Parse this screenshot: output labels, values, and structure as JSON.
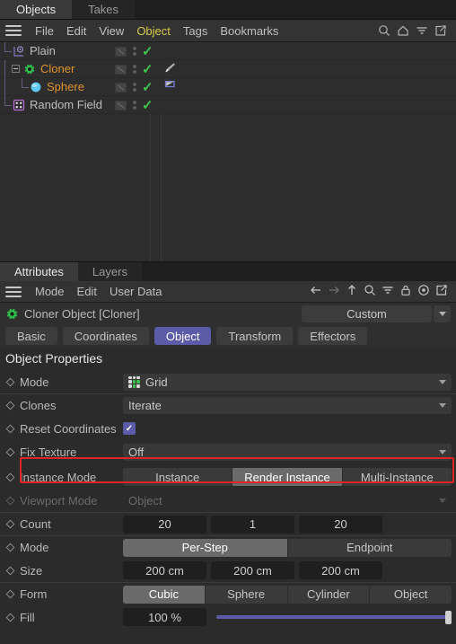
{
  "object_manager": {
    "tabs": [
      {
        "label": "Objects",
        "active": true
      },
      {
        "label": "Takes",
        "active": false
      }
    ],
    "menu": [
      "File",
      "Edit",
      "View",
      "Object",
      "Tags",
      "Bookmarks"
    ],
    "menu_highlight": "Object",
    "icons": [
      "search-icon",
      "home-icon",
      "filter-icon",
      "expand-icon"
    ],
    "tree": [
      {
        "name": "Plain",
        "icon": "plain-effector-icon",
        "color": "#bdbdbd",
        "depth": 0,
        "has_expander": false,
        "tag": null
      },
      {
        "name": "Cloner",
        "icon": "cloner-icon",
        "color": "#e0922e",
        "depth": 0,
        "has_expander": true,
        "tag": "paintbrush-tag"
      },
      {
        "name": "Sphere",
        "icon": "sphere-icon",
        "color": "#e0922e",
        "depth": 1,
        "has_expander": false,
        "tag": "flag-tag"
      },
      {
        "name": "Random Field",
        "icon": "random-field-icon",
        "color": "#bdbdbd",
        "depth": 0,
        "has_expander": false,
        "tag": null
      }
    ]
  },
  "attribute_manager": {
    "tabs": [
      {
        "label": "Attributes",
        "active": true
      },
      {
        "label": "Layers",
        "active": false
      }
    ],
    "menu": [
      "Mode",
      "Edit",
      "User Data"
    ],
    "icons": [
      "back-arrow-icon",
      "forward-arrow-icon",
      "up-arrow-icon",
      "search-icon",
      "filter-icon",
      "lock-icon",
      "target-icon",
      "expand-icon"
    ],
    "title": "Cloner Object [Cloner]",
    "title_icon": "cloner-icon",
    "preset": "Custom",
    "tabs2": [
      {
        "label": "Basic",
        "selected": false
      },
      {
        "label": "Coordinates",
        "selected": false
      },
      {
        "label": "Object",
        "selected": true
      },
      {
        "label": "Transform",
        "selected": false
      },
      {
        "label": "Effectors",
        "selected": false
      }
    ],
    "section_title": "Object Properties",
    "properties": {
      "mode": {
        "label": "Mode",
        "value": "Grid",
        "icon": "grid-icon"
      },
      "clones": {
        "label": "Clones",
        "value": "Iterate"
      },
      "reset_coordinates": {
        "label": "Reset Coordinates",
        "checked": true
      },
      "fix_texture": {
        "label": "Fix Texture",
        "value": "Off"
      },
      "instance_mode": {
        "label": "Instance Mode",
        "options": [
          "Instance",
          "Render Instance",
          "Multi-Instance"
        ],
        "selected": "Render Instance",
        "highlighted": true
      },
      "viewport_mode": {
        "label": "Viewport Mode",
        "value": "Object",
        "disabled": true
      },
      "count": {
        "label": "Count",
        "values": [
          "20",
          "1",
          "20"
        ]
      },
      "step_mode": {
        "label": "Mode",
        "options": [
          "Per-Step",
          "Endpoint"
        ],
        "selected": "Per-Step"
      },
      "size": {
        "label": "Size",
        "values": [
          "200 cm",
          "200 cm",
          "200 cm"
        ]
      },
      "form": {
        "label": "Form",
        "options": [
          "Cubic",
          "Sphere",
          "Cylinder",
          "Object"
        ],
        "selected": "Cubic"
      },
      "fill": {
        "label": "Fill",
        "value": "100 %",
        "percent": 100
      }
    }
  },
  "colors": {
    "accent_purple": "#5b5ba8",
    "highlight_red": "#e02424",
    "check_green": "#3fc44f",
    "menu_highlight": "#d8c84a",
    "object_orange": "#e0922e"
  }
}
